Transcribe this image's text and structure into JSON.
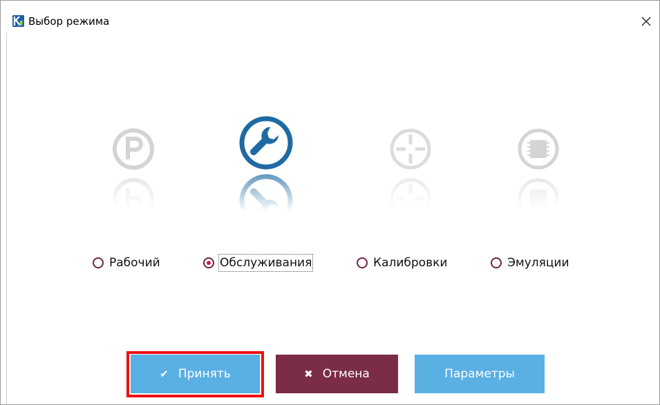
{
  "window": {
    "title": "Выбор режима"
  },
  "modes": [
    {
      "id": "working",
      "label": "Рабочий",
      "icon": "parking-p-icon",
      "selected": false
    },
    {
      "id": "service",
      "label": "Обслуживания",
      "icon": "wrench-icon",
      "selected": true
    },
    {
      "id": "calibration",
      "label": "Калибровки",
      "icon": "crosshair-icon",
      "selected": false
    },
    {
      "id": "emulation",
      "label": "Эмуляции",
      "icon": "chip-icon",
      "selected": false
    }
  ],
  "buttons": {
    "accept_label": "Принять",
    "cancel_label": "Отмена",
    "params_label": "Параметры"
  },
  "colors": {
    "active_icon": "#1f6aa3",
    "inactive_icon": "#d4d4d4",
    "accent_blue": "#5aafe3",
    "cancel_maroon": "#7b2c48",
    "highlight_red": "#ee1111",
    "radio_checked": "#c2185b"
  }
}
